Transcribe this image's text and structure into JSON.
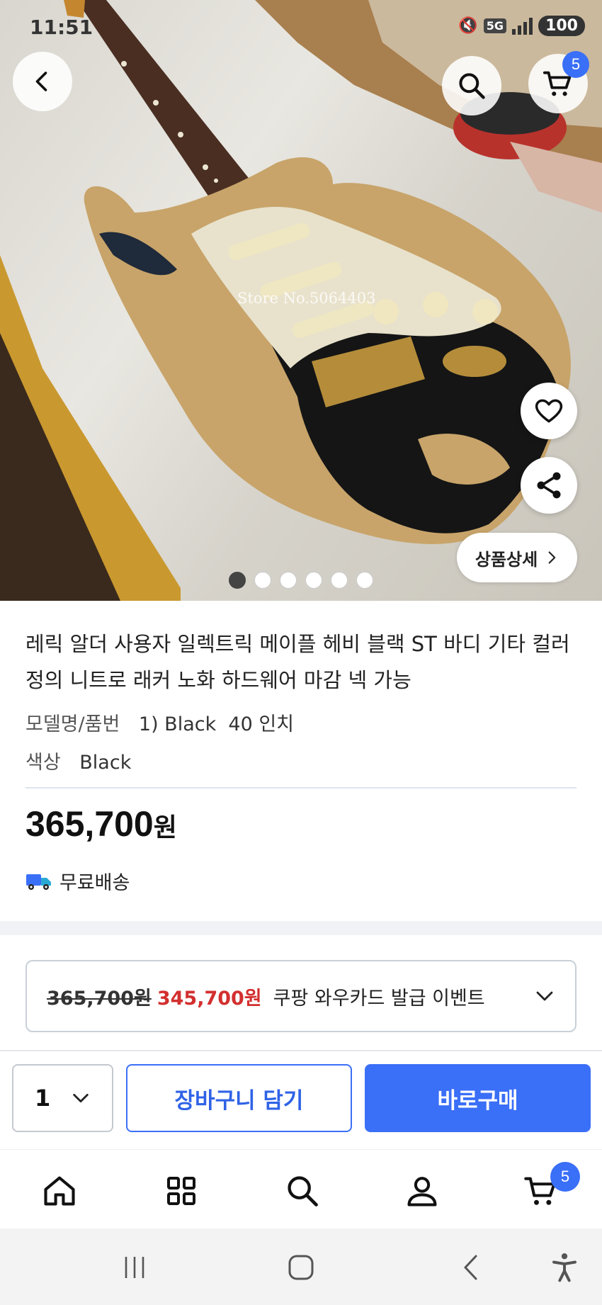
{
  "status_bar": {
    "time": "11:51",
    "network": "5G",
    "battery": "100"
  },
  "hero": {
    "watermark": "Store No.5064403",
    "cart_count": "5",
    "detail_button_label": "상품상세",
    "slide_count": 6,
    "active_slide": 1
  },
  "product": {
    "title": "레릭 알더 사용자 일렉트릭 메이플 헤비 블랙 ST 바디 기타 컬러 정의 니트로 래커 노화 하드웨어 마감 넥 가능",
    "specs": [
      {
        "label": "모델명/품번",
        "value": "1) Black  40 인치"
      },
      {
        "label": "색상",
        "value": "Black"
      }
    ],
    "price": "365,700",
    "currency": "원",
    "shipping": "무료배송"
  },
  "coupon": {
    "original_price": "365,700원",
    "discount_price": "345,700원",
    "text": "쿠팡 와우카드 발급 이벤트"
  },
  "buy_bar": {
    "quantity": "1",
    "add_to_cart_label": "장바구니 담기",
    "buy_now_label": "바로구매"
  },
  "bottom_nav": {
    "cart_count": "5",
    "items": [
      "home-icon",
      "category-icon",
      "search-icon",
      "profile-icon",
      "cart-icon"
    ]
  },
  "colors": {
    "accent": "#3a6ff7",
    "discount": "#d32f2f",
    "band": "#f0f2f5"
  }
}
